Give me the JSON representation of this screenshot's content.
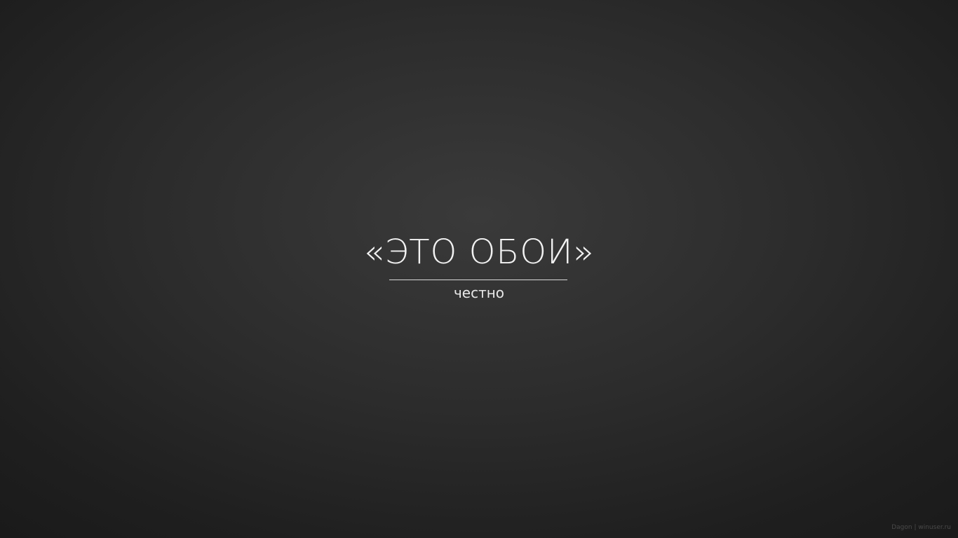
{
  "wallpaper": {
    "title": "«ЭТО ОБОИ»",
    "subtitle": "честно",
    "credit": "Dagon | winuser.ru"
  }
}
